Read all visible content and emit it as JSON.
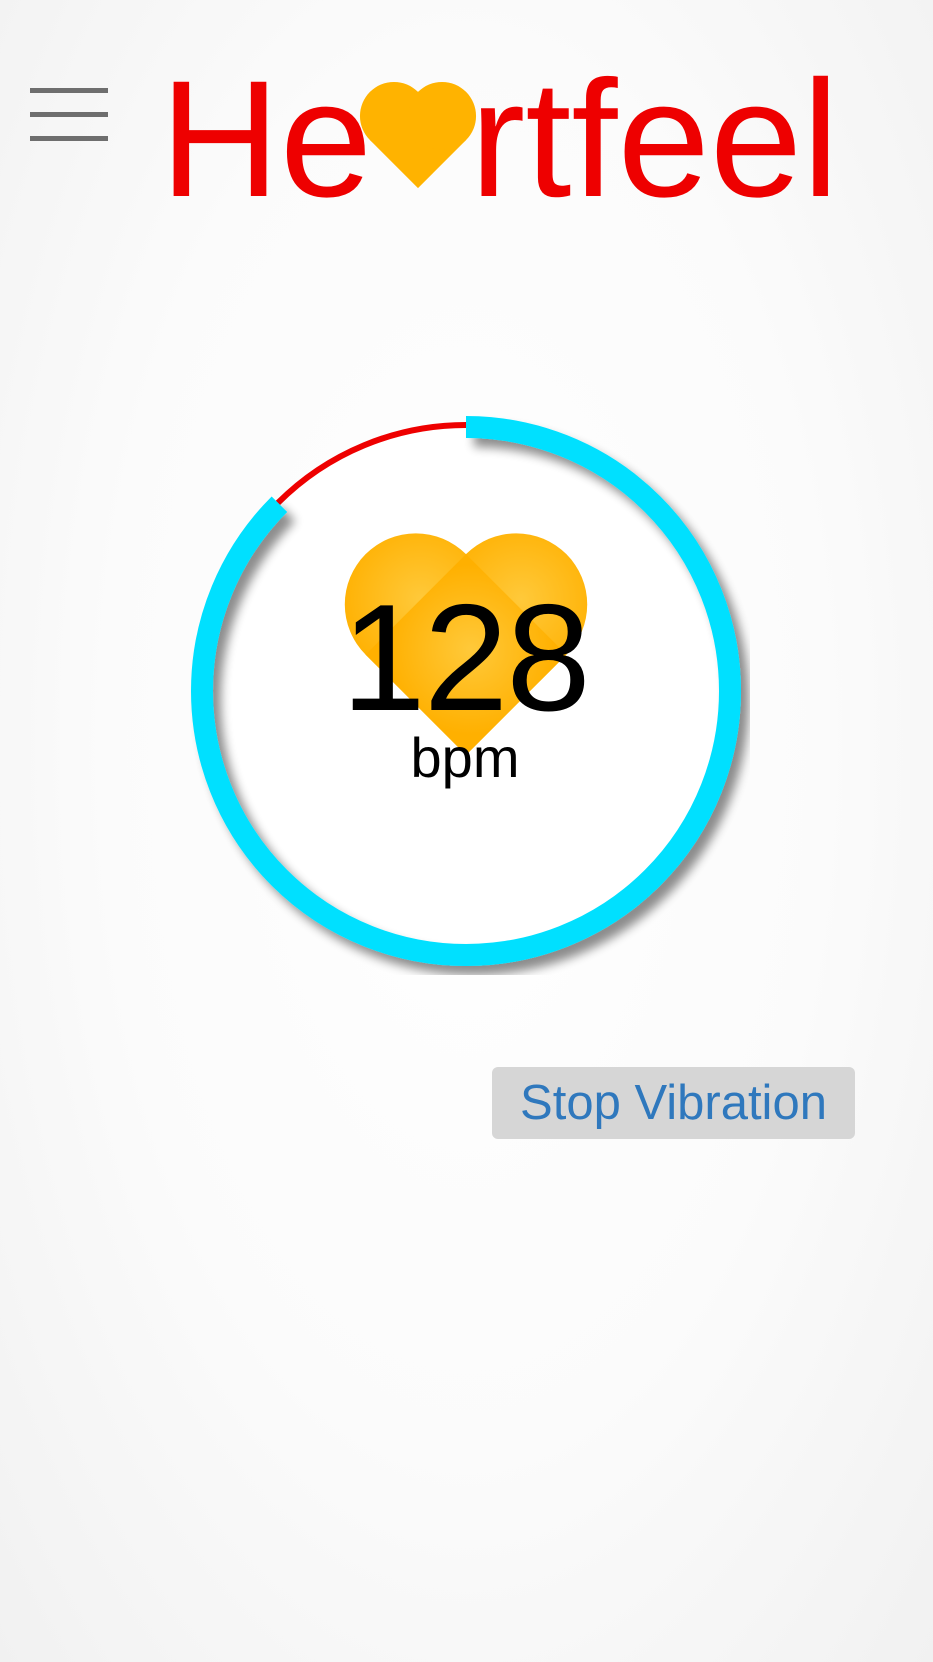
{
  "header": {
    "logo_text": "Heartfeel",
    "logo_color": "#ee0000",
    "logo_heart_color": "#ffb300"
  },
  "menu": {
    "icon": "hamburger-menu-icon"
  },
  "heart_rate": {
    "value": "128",
    "unit": "bpm",
    "heart_color": "#ffb300",
    "ring_color": "#00e0ff",
    "ring_remaining_color": "#ee0000",
    "ring_progress_fraction": 0.875
  },
  "actions": {
    "stop_vibration_label": "Stop Vibration"
  }
}
